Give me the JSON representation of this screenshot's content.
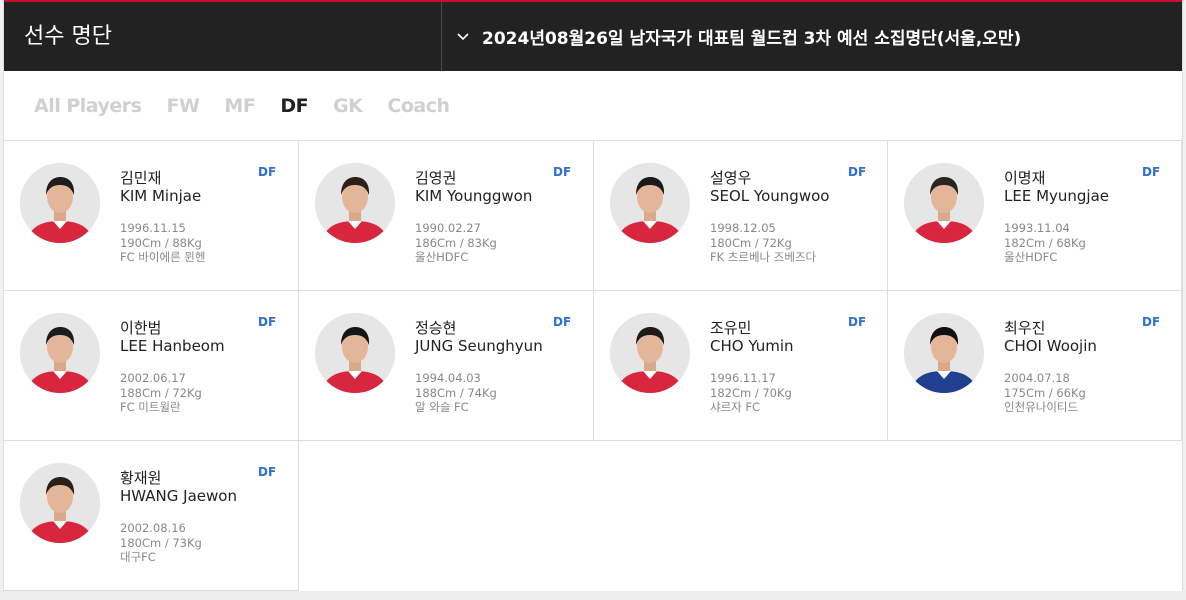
{
  "header": {
    "title": "선수 명단",
    "squad_selector": "2024년08월26일 남자국가 대표팀 월드컵 3차 예선 소집명단(서울,오만)"
  },
  "filters": [
    {
      "label": "All Players",
      "active": false
    },
    {
      "label": "FW",
      "active": false
    },
    {
      "label": "MF",
      "active": false
    },
    {
      "label": "DF",
      "active": true
    },
    {
      "label": "GK",
      "active": false
    },
    {
      "label": "Coach",
      "active": false
    }
  ],
  "players": [
    {
      "kor": "김민재",
      "eng": "KIM Minjae",
      "pos": "DF",
      "dob": "1996.11.15",
      "body": "190Cm / 88Kg",
      "club": "FC 바이에른 뮌헨",
      "kit": "red",
      "hair": "#1d1d1d"
    },
    {
      "kor": "김영권",
      "eng": "KIM Younggwon",
      "pos": "DF",
      "dob": "1990.02.27",
      "body": "186Cm / 83Kg",
      "club": "울산HDFC",
      "kit": "red",
      "hair": "#2a211c"
    },
    {
      "kor": "설영우",
      "eng": "SEOL Youngwoo",
      "pos": "DF",
      "dob": "1998.12.05",
      "body": "180Cm / 72Kg",
      "club": "FK 츠르베나 즈베즈다",
      "kit": "red",
      "hair": "#1a1a1a"
    },
    {
      "kor": "이명재",
      "eng": "LEE Myungjae",
      "pos": "DF",
      "dob": "1993.11.04",
      "body": "182Cm / 68Kg",
      "club": "울산HDFC",
      "kit": "red",
      "hair": "#2b2420"
    },
    {
      "kor": "이한범",
      "eng": "LEE Hanbeom",
      "pos": "DF",
      "dob": "2002.06.17",
      "body": "188Cm / 72Kg",
      "club": "FC 미트윌란",
      "kit": "red",
      "hair": "#1c1c1c"
    },
    {
      "kor": "정승현",
      "eng": "JUNG Seunghyun",
      "pos": "DF",
      "dob": "1994.04.03",
      "body": "188Cm / 74Kg",
      "club": "알 와슬 FC",
      "kit": "red",
      "hair": "#151515"
    },
    {
      "kor": "조유민",
      "eng": "CHO Yumin",
      "pos": "DF",
      "dob": "1996.11.17",
      "body": "182Cm / 70Kg",
      "club": "샤르자 FC",
      "kit": "red",
      "hair": "#1f1a17"
    },
    {
      "kor": "최우진",
      "eng": "CHOI Woojin",
      "pos": "DF",
      "dob": "2004.07.18",
      "body": "175Cm / 66Kg",
      "club": "인천유나이티드",
      "kit": "blue",
      "hair": "#111111"
    },
    {
      "kor": "황재원",
      "eng": "HWANG Jaewon",
      "pos": "DF",
      "dob": "2002.08.16",
      "body": "180Cm / 73Kg",
      "club": "대구FC",
      "kit": "red",
      "hair": "#2a1f1a"
    }
  ],
  "colors": {
    "header_bg": "#222222",
    "accent_red": "#c8102e",
    "position_blue": "#2f6fd6",
    "kit_red": "#d7263d",
    "kit_blue": "#1f3f8f"
  },
  "icons": {
    "selector": "chevron-down-icon"
  }
}
